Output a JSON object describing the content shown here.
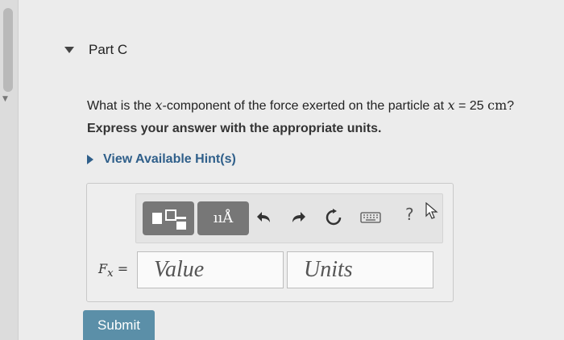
{
  "part": {
    "title": "Part C"
  },
  "question": {
    "prefix": "What is the ",
    "var1": "x",
    "mid": "-component of the force exerted on the particle at ",
    "var2": "x",
    "eq": " = 25 ",
    "unit": "cm",
    "suffix": "?"
  },
  "instruction": "Express your answer with the appropriate units.",
  "hint": {
    "label": "View Available Hint(s)"
  },
  "toolbar": {
    "units_symbol": "ııÅ",
    "help": "?",
    "icons": [
      "templates-icon",
      "units-icon",
      "undo-icon",
      "redo-icon",
      "reset-icon",
      "keyboard-icon",
      "help-icon"
    ]
  },
  "answer": {
    "label_var": "F",
    "label_sub": "x",
    "label_eq": " =",
    "value_placeholder": "Value",
    "units_placeholder": "Units"
  },
  "submit": {
    "label": "Submit"
  },
  "colors": {
    "accent": "#2f5f8a",
    "submit": "#5b8fa8",
    "toolbar_button": "#777777"
  }
}
